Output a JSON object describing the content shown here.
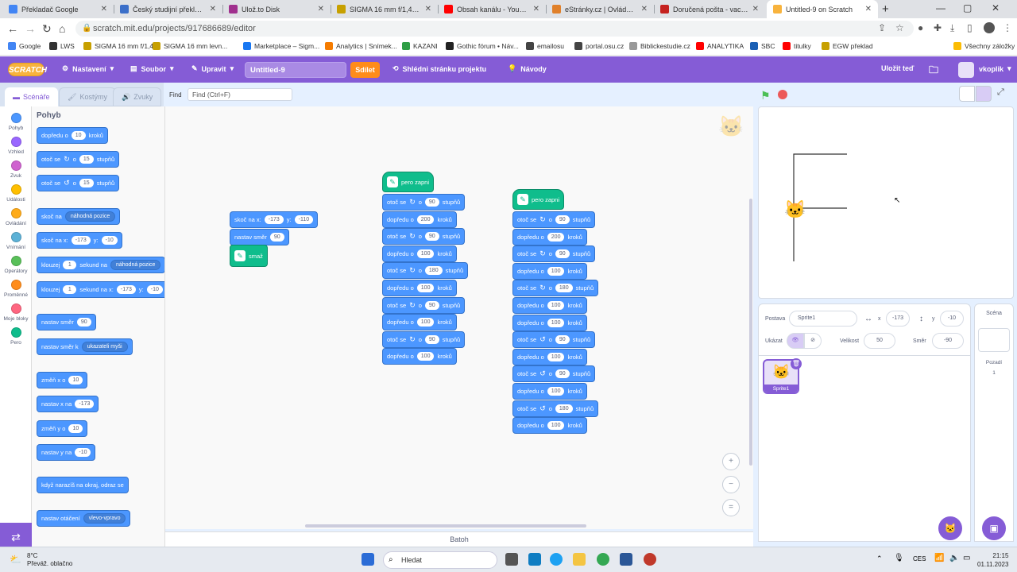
{
  "tabs": [
    {
      "title": "Překladač Google",
      "color": "#4285f4"
    },
    {
      "title": "Český studijní překlad - E",
      "color": "#3b6fc9"
    },
    {
      "title": "Ulož.to Disk",
      "color": "#a0308e"
    },
    {
      "title": "SIGMA 16 mm f/1,4 DC D",
      "color": "#c7a000"
    },
    {
      "title": "Obsah kanálu - YouTube",
      "color": "#ff0000"
    },
    {
      "title": "eStránky.cz | Ovládací cen",
      "color": "#e0802a"
    },
    {
      "title": "Doručená pošta - vaclav.k",
      "color": "#c5221f"
    },
    {
      "title": "Untitled-9 on Scratch",
      "color": "#f8b33d"
    }
  ],
  "url": "scratch.mit.edu/projects/917686689/editor",
  "bookmarks": [
    {
      "label": "Google",
      "color": "#4285f4"
    },
    {
      "label": "LWS",
      "color": "#333"
    },
    {
      "label": "SIGMA 16 mm f/1,4...",
      "color": "#c7a000"
    },
    {
      "label": "SIGMA 16 mm levn...",
      "color": "#c7a000"
    },
    {
      "label": "Marketplace – Sigm...",
      "color": "#1877f2"
    },
    {
      "label": "Analytics | Snímek...",
      "color": "#f57c00"
    },
    {
      "label": "KAZANI",
      "color": "#2e9e45"
    },
    {
      "label": "Gothic fórum • Náv...",
      "color": "#222"
    },
    {
      "label": "emailosu",
      "color": "#444"
    },
    {
      "label": "portal.osu.cz",
      "color": "#444"
    },
    {
      "label": "Biblickestudie.cz",
      "color": "#999"
    },
    {
      "label": "ANALYTIKA",
      "color": "#ff0000"
    },
    {
      "label": "SBC",
      "color": "#1a5fb4"
    },
    {
      "label": "titulky",
      "color": "#ff0000"
    },
    {
      "label": "EGW překlad",
      "color": "#c7a000"
    }
  ],
  "all_bookmarks": "Všechny záložky",
  "menu": {
    "logo": "SCRATCH",
    "settings": "Nastavení",
    "file": "Soubor",
    "edit": "Upravit",
    "project_title": "Untitled-9",
    "share": "Sdílet",
    "see_project": "Shlédni stránku projektu",
    "tutorials": "Návody",
    "save_now": "Uložit teď",
    "user": "vkoplik"
  },
  "editor_tabs": {
    "code": "Scénáře",
    "costumes": "Kostýmy",
    "sounds": "Zvuky"
  },
  "find": {
    "label": "Find",
    "placeholder": "Find (Ctrl+F)"
  },
  "categories": [
    {
      "label": "Pohyb",
      "color": "#4c97ff"
    },
    {
      "label": "Vzhled",
      "color": "#9966ff"
    },
    {
      "label": "Zvuk",
      "color": "#cf63cf"
    },
    {
      "label": "Události",
      "color": "#ffbf00"
    },
    {
      "label": "Ovládání",
      "color": "#ffab19"
    },
    {
      "label": "Vnímání",
      "color": "#5cb1d6"
    },
    {
      "label": "Operátory",
      "color": "#59c059"
    },
    {
      "label": "Proměnné",
      "color": "#ff8c1a"
    },
    {
      "label": "Moje bloky",
      "color": "#ff6680"
    },
    {
      "label": "Pero",
      "color": "#0fbd8c"
    }
  ],
  "palette": {
    "title": "Pohyb",
    "b1": [
      "dopředu o",
      "10",
      "kroků"
    ],
    "b2": [
      "otoč se",
      "o",
      "15",
      "stupňů"
    ],
    "b3": [
      "otoč se",
      "o",
      "15",
      "stupňů"
    ],
    "b4": [
      "skoč na",
      "náhodná pozice"
    ],
    "b5": [
      "skoč na x:",
      "-173",
      "y:",
      "-10"
    ],
    "b6": [
      "klouzej",
      "1",
      "sekund na",
      "náhodná pozice"
    ],
    "b7": [
      "klouzej",
      "1",
      "sekund na x:",
      "-173",
      "y:",
      "-10"
    ],
    "b8": [
      "nastav směr",
      "90"
    ],
    "b9": [
      "nastav směr k",
      "ukazateli myši"
    ],
    "b10": [
      "změň x o",
      "10"
    ],
    "b11": [
      "nastav x na",
      "-173"
    ],
    "b12": [
      "změň y o",
      "10"
    ],
    "b13": [
      "nastav y na",
      "-10"
    ],
    "b14": [
      "když narazíš na okraj, odraz se"
    ],
    "b15": [
      "nastav otáčení",
      "vlevo-vpravo"
    ]
  },
  "script1": {
    "goto": [
      "skoč na x:",
      "-173",
      "y:",
      "-110"
    ],
    "dir": [
      "nastav směr",
      "90"
    ],
    "clear": "smaž"
  },
  "script2": {
    "hat": "pero zapni",
    "rows": [
      [
        "otoč se",
        "o",
        "90",
        "stupňů"
      ],
      [
        "dopředu o",
        "200",
        "kroků"
      ],
      [
        "otoč se",
        "o",
        "90",
        "stupňů"
      ],
      [
        "dopředu o",
        "100",
        "kroků"
      ],
      [
        "otoč se",
        "o",
        "180",
        "stupňů"
      ],
      [
        "dopředu o",
        "100",
        "kroků"
      ],
      [
        "otoč se",
        "o",
        "90",
        "stupňů"
      ],
      [
        "dopředu o",
        "100",
        "kroků"
      ],
      [
        "otoč se",
        "o",
        "90",
        "stupňů"
      ],
      [
        "dopředu o",
        "100",
        "kroků"
      ]
    ]
  },
  "script3": {
    "hat": "pero zapni",
    "rows": [
      [
        "otoč se",
        "o",
        "90",
        "stupňů"
      ],
      [
        "dopředu o",
        "200",
        "kroků"
      ],
      [
        "otoč se",
        "o",
        "90",
        "stupňů"
      ],
      [
        "dopředu o",
        "100",
        "kroků"
      ],
      [
        "otoč se",
        "o",
        "180",
        "stupňů"
      ],
      [
        "dopředu o",
        "100",
        "kroků"
      ],
      [
        "dopředu o",
        "100",
        "kroků"
      ],
      [
        "otoč se",
        "o",
        "90",
        "stupňů"
      ],
      [
        "dopředu o",
        "100",
        "kroků"
      ],
      [
        "otoč se",
        "o",
        "90",
        "stupňů"
      ],
      [
        "dopředu o",
        "100",
        "kroků"
      ],
      [
        "otoč se",
        "o",
        "180",
        "stupňů"
      ],
      [
        "dopředu o",
        "100",
        "kroků"
      ]
    ]
  },
  "backpack": "Batoh",
  "sprite": {
    "label": "Postava",
    "name": "Sprite1",
    "x_label": "x",
    "x": "-173",
    "y_label": "y",
    "y": "-10",
    "show_label": "Ukázat",
    "size_label": "Velikost",
    "size": "50",
    "direction_label": "Směr",
    "direction": "-90",
    "thumb_name": "Sprite1"
  },
  "stage_panel": {
    "title": "Scéna",
    "backdrops_label": "Pozadí",
    "backdrops_count": "1"
  },
  "taskbar": {
    "temp": "8°C",
    "weather": "Převáž. oblačno",
    "search": "Hledat",
    "lang": "CES",
    "time": "21:15",
    "date": "01.11.2023"
  }
}
